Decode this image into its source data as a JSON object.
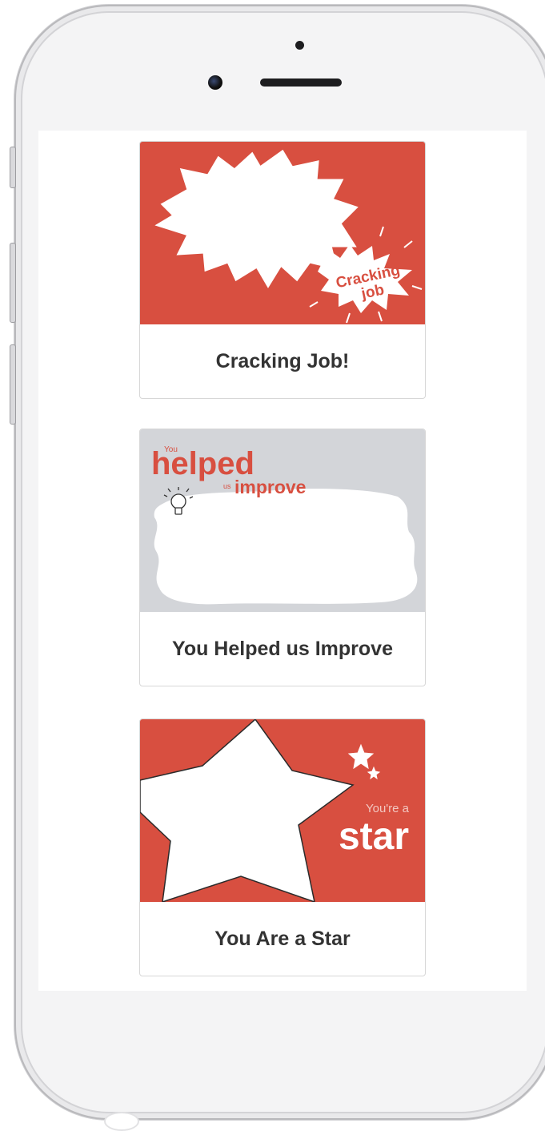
{
  "cards": [
    {
      "title": "Cracking Job!",
      "image_text": [
        "Cracking",
        "job"
      ],
      "image_bg": "#d84f40"
    },
    {
      "title": "You Helped us Improve",
      "image_text": [
        "You",
        "helped",
        "us",
        "improve"
      ],
      "image_bg": "#d3d5d9"
    },
    {
      "title": "You Are a Star",
      "image_text": [
        "You're a",
        "star"
      ],
      "image_bg": "#d84f40"
    }
  ],
  "colors": {
    "accent": "#d84f40",
    "card_border": "#d7d7d7",
    "title_text": "#333333"
  }
}
